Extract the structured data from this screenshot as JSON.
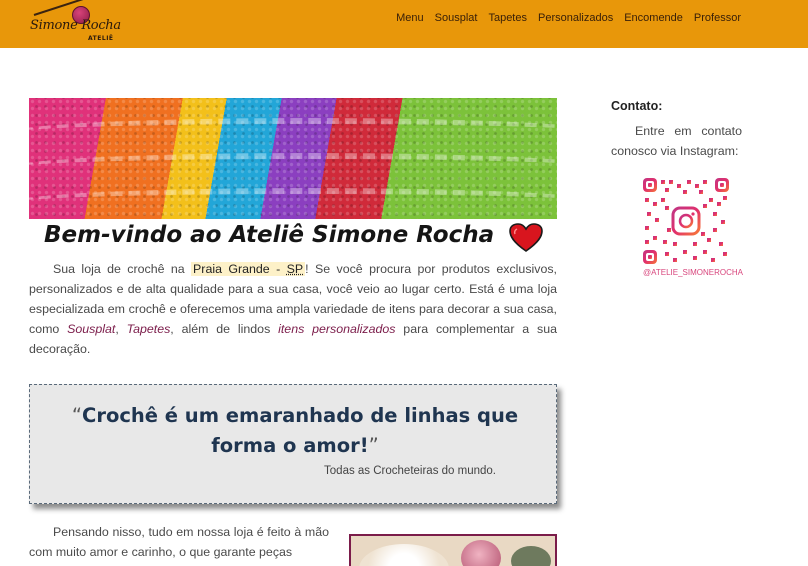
{
  "header": {
    "logo_name": "Simone Rocha",
    "logo_sub": "ATELIÊ",
    "nav": [
      "Menu",
      "Sousplat",
      "Tapetes",
      "Personalizados",
      "Encomende",
      "Professor"
    ]
  },
  "main": {
    "title": "Bem-vindo ao Ateliê Simone Rocha",
    "intro": {
      "p1": "Sua loja de crochê na ",
      "location": "Praia Grande - ",
      "state": "SP",
      "p2": "! Se você procura por produtos exclusivos, personalizados e de alta qualidade para a sua casa, você veio ao lugar certo. Está é uma loja especializada em crochê e oferecemos uma ampla variedade de itens para decorar a sua casa, como ",
      "link1": "Sousplat",
      "p3": ", ",
      "link2": "Tapetes",
      "p4": ", além de lindos ",
      "link3": "itens personalizados",
      "p5": " para complementar a sua decoração."
    },
    "quote": {
      "open": "“",
      "text": "Crochê é um emaranhado de linhas que forma o amor!",
      "close": "”",
      "author": "Todas as Crocheteiras do mundo."
    },
    "lower_text": "Pensando nisso, tudo em nossa loja é feito à mão com muito amor e carinho, o que garante peças"
  },
  "sidebar": {
    "contact_title": "Contato:",
    "contact_text": "Entre em contato conosco via Instagram:",
    "instagram_handle": "@ATELIE_SIMONEROCHA"
  },
  "colors": {
    "header_bg": "#e8970a",
    "link": "#7b1c4a",
    "quote_text": "#1f3550",
    "highlight": "#fdf1c8",
    "heart": "#d8151e"
  },
  "icons": {
    "heart": "heart-icon",
    "qr": "instagram-qr-code"
  }
}
